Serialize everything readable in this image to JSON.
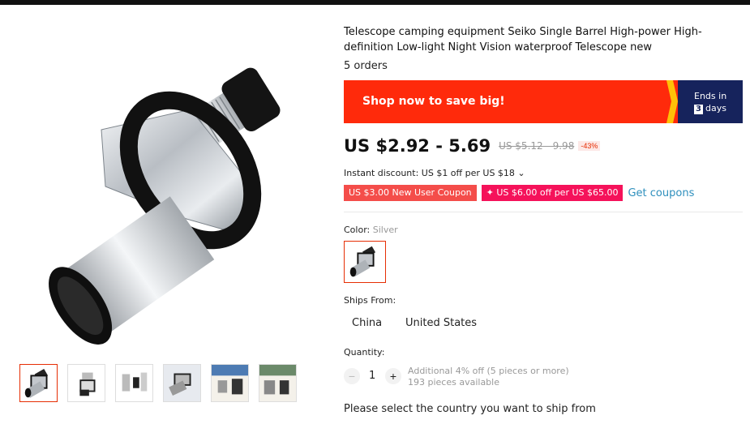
{
  "product": {
    "title": "Telescope camping equipment Seiko Single Barrel High-power High-definition Low-light Night Vision waterproof Telescope new",
    "orders": "5 orders"
  },
  "promo": {
    "headline": "Shop now to save big!",
    "ends_label": "Ends in",
    "days_number": "3",
    "days_label": "days",
    "color": "#ff2a0b",
    "ends_bg": "#16235c"
  },
  "pricing": {
    "price": "US $2.92 - 5.69",
    "original_price": "US $5.12 - 9.98",
    "discount": "-43%",
    "instant_discount": "Instant discount: US $1 off per US $18 ⌄"
  },
  "coupons": {
    "items": [
      "US $3.00 New User Coupon",
      "✦ US $6.00 off per US $65.00"
    ],
    "get_label": "Get coupons"
  },
  "color": {
    "label": "Color: ",
    "selected": "Silver"
  },
  "shipping": {
    "label": "Ships From:",
    "options": [
      "China",
      "United States"
    ]
  },
  "quantity": {
    "label": "Quantity:",
    "value": "1",
    "minus": "−",
    "plus": "+",
    "note_line1": "Additional 4% off (5 pieces or more)",
    "note_line2": "193 pieces available"
  },
  "footer_note": "Please select the country you want to ship from",
  "gallery": {
    "thumbnails": [
      "thumb-1",
      "thumb-2",
      "thumb-3",
      "thumb-4",
      "thumb-5",
      "thumb-6"
    ],
    "active_index": 0
  }
}
